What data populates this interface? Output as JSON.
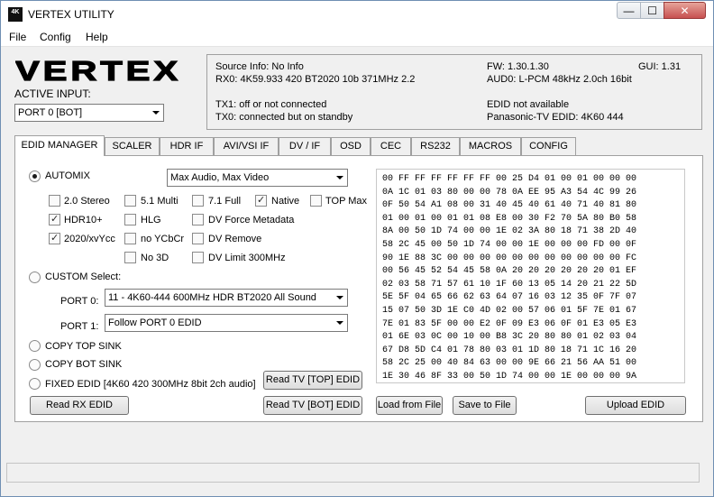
{
  "window": {
    "title": "VERTEX UTILITY",
    "icon_text": "4K",
    "minimize_glyph": "—",
    "maximize_glyph": "☐",
    "close_glyph": "✕"
  },
  "menu": {
    "file": "File",
    "config": "Config",
    "help": "Help"
  },
  "logo_text": "VERTEX",
  "active_input": {
    "label": "ACTIVE INPUT:",
    "selected": "PORT 0 [BOT]"
  },
  "info": {
    "source_info": "Source Info: No Info",
    "rx0": "RX0: 4K59.933 420 BT2020 10b 371MHz 2.2",
    "tx1": "TX1: off or not connected",
    "tx0": "TX0: connected but on standby",
    "fw": "FW: 1.30.1.30",
    "gui": "GUI: 1.31",
    "audio": "AUD0: L-PCM 48kHz 2.0ch 16bit",
    "edid_status": "EDID not available",
    "edid_name": "Panasonic-TV EDID: 4K60 444"
  },
  "tabs": [
    {
      "label": "EDID MANAGER",
      "active": true
    },
    {
      "label": "SCALER"
    },
    {
      "label": "HDR IF"
    },
    {
      "label": "AVI/VSI IF"
    },
    {
      "label": "DV / IF"
    },
    {
      "label": "OSD"
    },
    {
      "label": "CEC"
    },
    {
      "label": "RS232"
    },
    {
      "label": "MACROS"
    },
    {
      "label": "CONFIG"
    }
  ],
  "edid": {
    "automix_label": "AUTOMIX",
    "automix_selected": true,
    "automix_mode": "Max Audio, Max Video",
    "options": {
      "stereo": {
        "label": "2.0 Stereo",
        "checked": false
      },
      "multi51": {
        "label": "5.1 Multi",
        "checked": false
      },
      "full71": {
        "label": "7.1 Full",
        "checked": false
      },
      "native": {
        "label": "Native",
        "checked": true
      },
      "topmax": {
        "label": "TOP Max",
        "checked": false
      },
      "hdr10": {
        "label": "HDR10+",
        "checked": true
      },
      "hlg": {
        "label": "HLG",
        "checked": false
      },
      "dvforce": {
        "label": "DV Force Metadata",
        "checked": false
      },
      "xvycc": {
        "label": "2020/xvYcc",
        "checked": true
      },
      "noycbcr": {
        "label": "no YCbCr",
        "checked": false
      },
      "dvremove": {
        "label": "DV Remove",
        "checked": false
      },
      "no3d": {
        "label": "No 3D",
        "checked": false
      },
      "dvlimit": {
        "label": "DV Limit 300MHz",
        "checked": false
      }
    },
    "custom_label": "CUSTOM Select:",
    "port0_label": "PORT 0:",
    "port0_value": "11 - 4K60-444 600MHz HDR BT2020 All Sound",
    "port1_label": "PORT 1:",
    "port1_value": "Follow PORT 0 EDID",
    "copy_top": "COPY TOP SINK",
    "copy_bot": "COPY BOT SINK",
    "fixed": "FIXED EDID [4K60 420 300MHz 8bit 2ch audio]",
    "buttons": {
      "read_tv_top": "Read TV [TOP] EDID",
      "read_tv_bot": "Read TV [BOT] EDID",
      "read_rx": "Read RX  EDID",
      "load_file": "Load from File",
      "save_file": "Save to File",
      "upload": "Upload EDID"
    },
    "hex": [
      "00 FF FF FF FF FF FF 00 25 D4 01 00 01 00 00 00",
      "0A 1C 01 03 80 00 00 78 0A EE 95 A3 54 4C 99 26",
      "0F 50 54 A1 08 00 31 40 45 40 61 40 71 40 81 80",
      "01 00 01 00 01 01 08 E8 00 30 F2 70 5A 80 B0 58",
      "8A 00 50 1D 74 00 00 1E 02 3A 80 18 71 38 2D 40",
      "58 2C 45 00 50 1D 74 00 00 1E 00 00 00 FD 00 0F",
      "90 1E 88 3C 00 00 00 00 00 00 00 00 00 00 00 FC",
      "00 56 45 52 54 45 58 0A 20 20 20 20 20 20 01 EF",
      "02 03 58 71 57 61 10 1F 60 13 05 14 20 21 22 5D",
      "5E 5F 04 65 66 62 63 64 07 16 03 12 35 0F 7F 07",
      "15 07 50 3D 1E C0 4D 02 00 57 06 01 5F 7E 01 67",
      "7E 01 83 5F 00 00 E2 0F 09 E3 06 0F 01 E3 05 E3",
      "01 6E 03 0C 00 10 00 B8 3C 20 80 80 01 02 03 04",
      "67 D8 5D C4 01 78 80 03 01 1D 80 18 71 1C 16 20",
      "58 2C 25 00 40 84 63 00 00 9E 66 21 56 AA 51 00",
      "1E 30 46 8F 33 00 50 1D 74 00 00 1E 00 00 00 9A"
    ]
  }
}
